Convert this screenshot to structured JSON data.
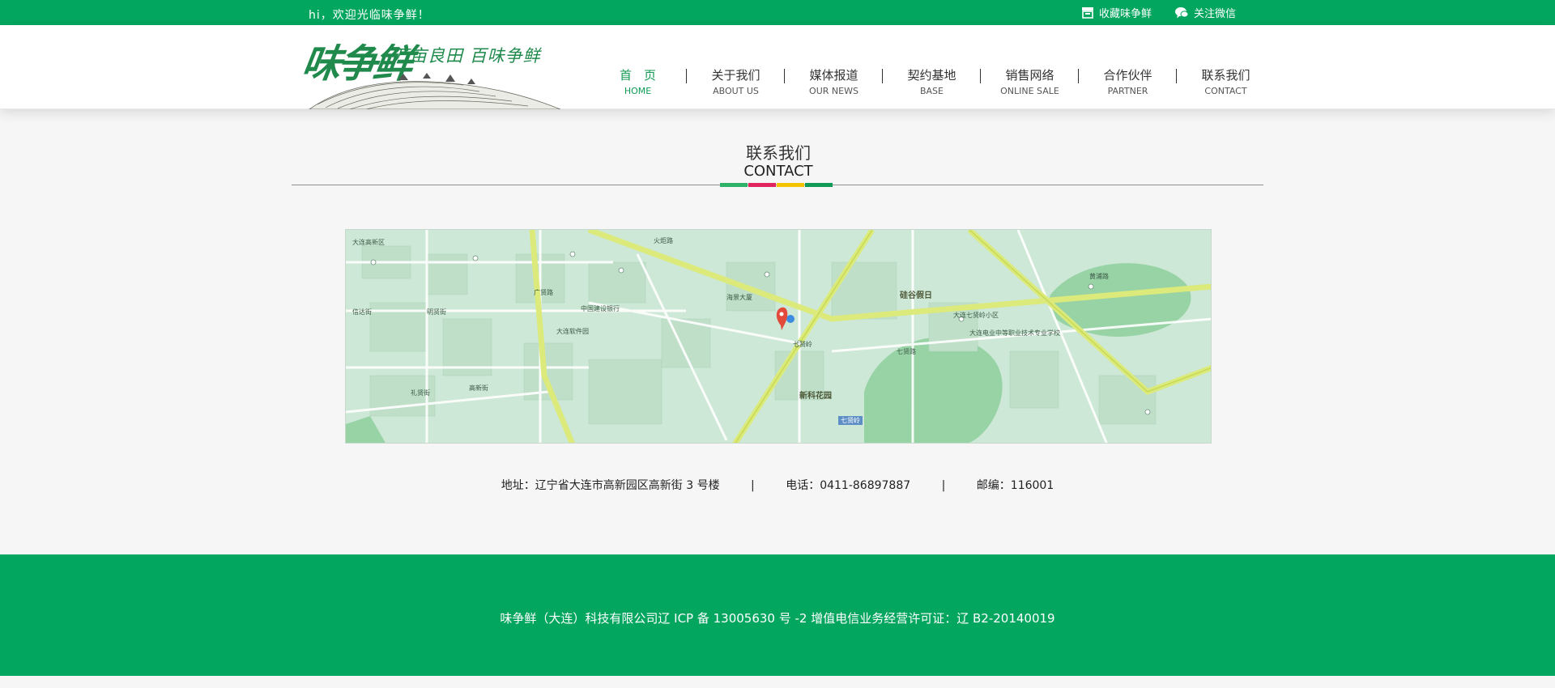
{
  "topbar": {
    "welcome": "hi，欢迎光临味争鲜！",
    "links": [
      {
        "label": "收藏味争鲜",
        "icon": "bookmark-icon"
      },
      {
        "label": "关注微信",
        "icon": "wechat-icon"
      }
    ]
  },
  "logo": {
    "brand": "味争鲜",
    "slogan": "万亩良田 百味争鲜"
  },
  "nav": {
    "items": [
      {
        "cn": "首　页",
        "en": "HOME",
        "active": true
      },
      {
        "cn": "关于我们",
        "en": "ABOUT US"
      },
      {
        "cn": "媒体报道",
        "en": "OUR NEWS"
      },
      {
        "cn": "契约基地",
        "en": "BASE"
      },
      {
        "cn": "销售网络",
        "en": "ONLINE SALE"
      },
      {
        "cn": "合作伙伴",
        "en": "PARTNER"
      },
      {
        "cn": "联系我们",
        "en": "CONTACT"
      }
    ]
  },
  "section": {
    "title_cn": "联系我们",
    "title_en": "CONTACT",
    "bar_colors": [
      "#2db267",
      "#e0245e",
      "#f5c400",
      "#0f9a55"
    ]
  },
  "map": {
    "labels": {
      "silicon": "硅谷假日",
      "xinke": "新科花园",
      "qixian": "七贤岭",
      "qixian_badge": "七贤岭",
      "huoju": "火炬路",
      "daxi": "大连高新区",
      "qixianlu": "七贤路",
      "guangxianlu": "广贤路",
      "huangpulu": "黄浦路",
      "huixianlu": "汇贤路",
      "xinxianjie": "信达街",
      "mingxianjie": "明贤街",
      "yuxianjie": "礼贤街",
      "gaoxinjie": "高新街",
      "school": "大连电业中等职业技术专业学校",
      "tower": "大连七贤岭小区",
      "park": "大连软件园",
      "hotel": "海景大厦",
      "bank": "中国建设银行"
    }
  },
  "contact": {
    "address": "地址：辽宁省大连市高新园区高新街 3 号楼",
    "phone": "电话：0411-86897887",
    "zip": "邮编：116001",
    "separator": "|"
  },
  "footer": {
    "copyright": "味争鲜（大连）科技有限公司辽 ICP 备 13005630 号 -2 增值电信业务经营许可证：辽 B2-20140019"
  },
  "colors": {
    "brand_green": "#02a65f",
    "nav_active": "#109a53"
  }
}
